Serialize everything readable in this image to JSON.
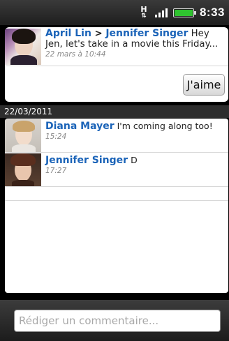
{
  "status_bar": {
    "network_label": "H",
    "network_arrows": "⇅",
    "time": "8:33",
    "battery_color": "#2fc32f",
    "icons": [
      "network-activity-icon",
      "signal-icon",
      "battery-icon"
    ]
  },
  "post": {
    "author": "April Lin",
    "separator": " > ",
    "recipient": "Jennifer Singer",
    "message": "Hey Jen, let's take in a movie this Friday...",
    "timestamp": "22 mars à 10:44",
    "like_label": "J'aime"
  },
  "date_header": "22/03/2011",
  "comments": [
    {
      "author": "Diana Mayer",
      "message": "I'm coming along too!",
      "time": "15:24"
    },
    {
      "author": "Jennifer Singer",
      "message": "D",
      "time": "17:27"
    }
  ],
  "composer": {
    "placeholder": "Rédiger un commentaire..."
  },
  "colors": {
    "name_link": "#1a63b8",
    "timestamp": "#8a8a8a",
    "background": "#000000"
  }
}
